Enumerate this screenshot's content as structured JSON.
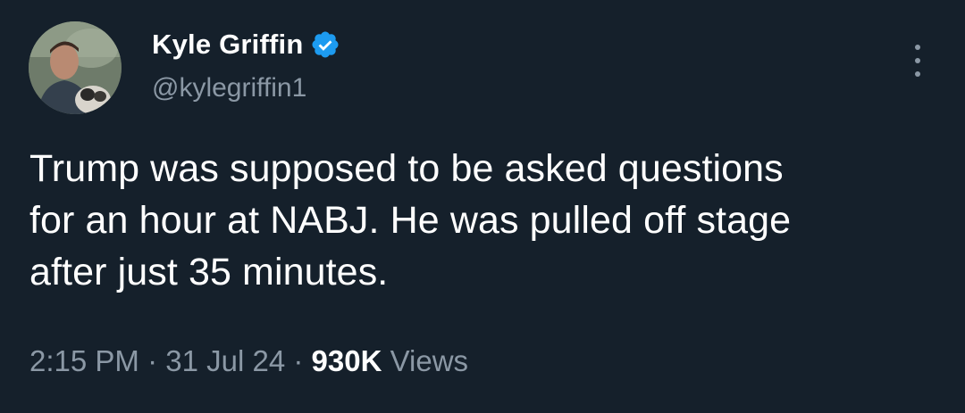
{
  "author": {
    "display_name": "Kyle Griffin",
    "handle": "@kylegriffin1",
    "verified_icon": "verified-badge-icon",
    "avatar": "profile-photo"
  },
  "tweet": {
    "lines": [
      "Trump was supposed to be asked questions",
      "for an hour at NABJ. He was pulled off stage",
      "after just 35 minutes."
    ]
  },
  "meta": {
    "time": "2:15 PM",
    "separator": "·",
    "date": "31 Jul 24",
    "views_count": "930K",
    "views_label": "Views"
  },
  "colors": {
    "background": "#15202b",
    "text": "#ffffff",
    "secondary": "#8b98a5",
    "verified": "#1d9bf0"
  }
}
